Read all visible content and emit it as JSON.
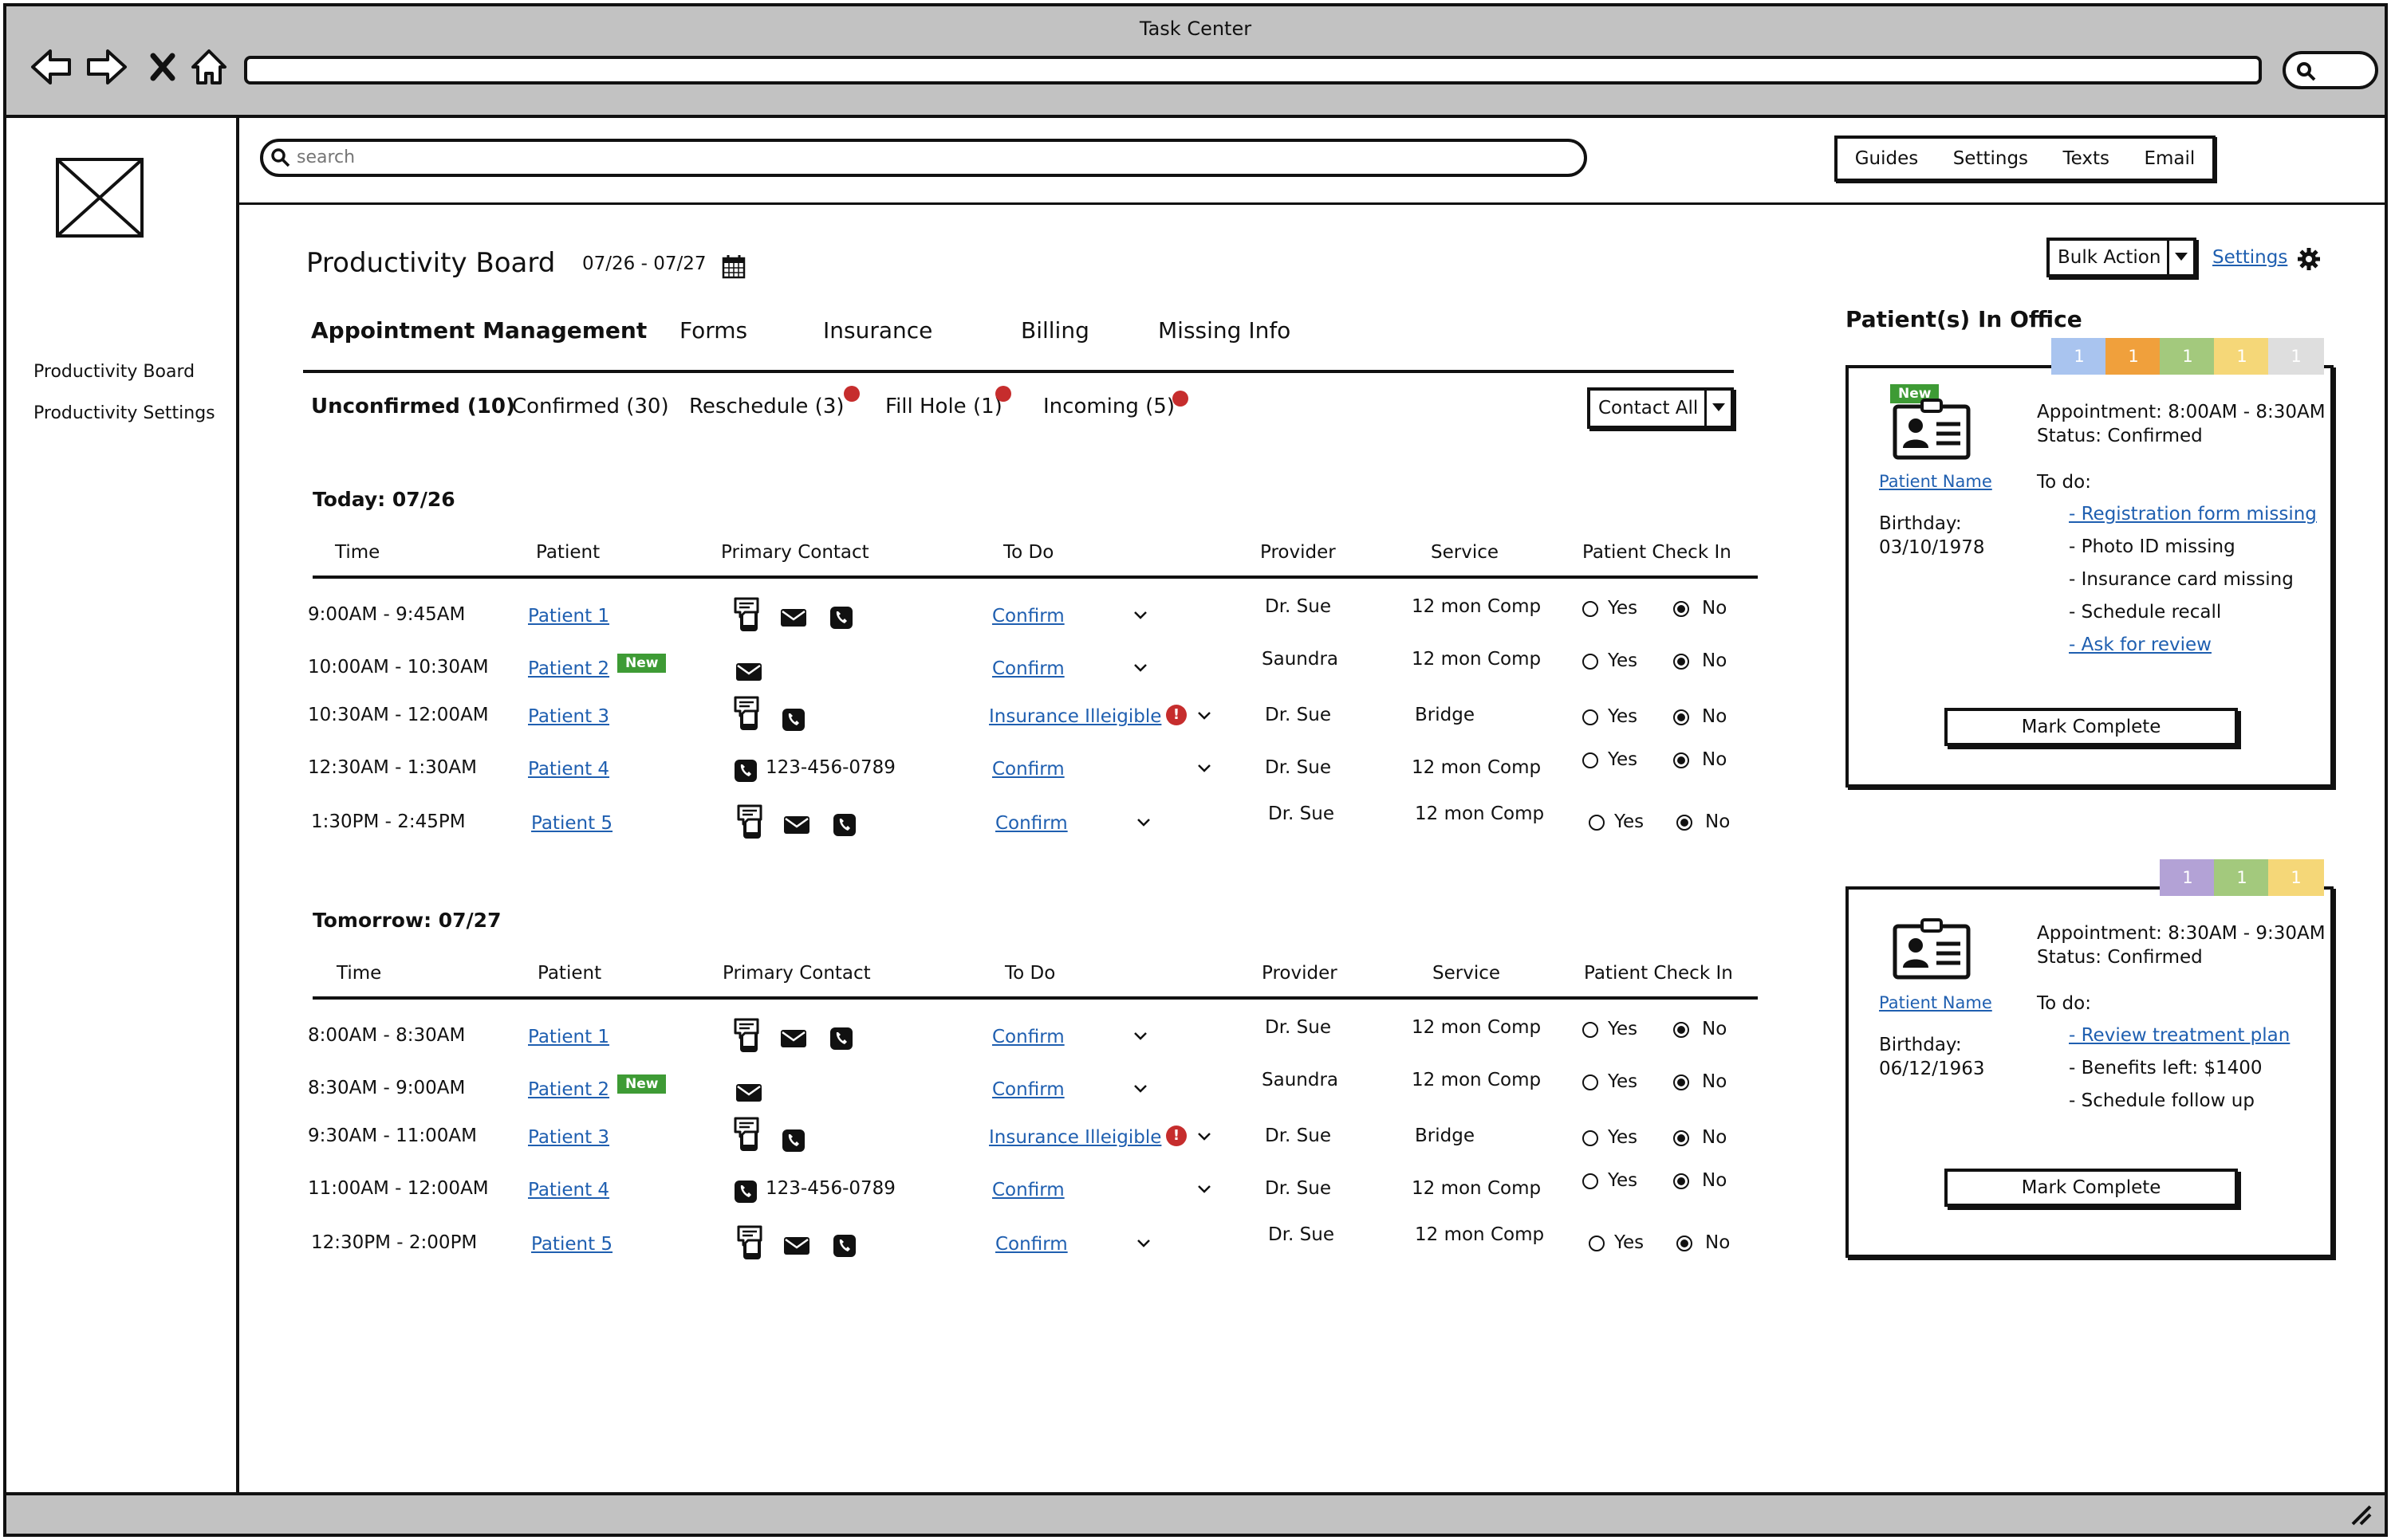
{
  "window": {
    "title": "Task Center"
  },
  "sidebar": {
    "items": [
      {
        "label": "Productivity Board"
      },
      {
        "label": "Productivity Settings"
      }
    ]
  },
  "search": {
    "placeholder": "search"
  },
  "top_menu": {
    "items": [
      {
        "label": "Guides"
      },
      {
        "label": "Settings"
      },
      {
        "label": "Texts"
      },
      {
        "label": "Email"
      }
    ]
  },
  "board": {
    "title": "Productivity Board",
    "date_range": "07/26 - 07/27",
    "bulk_action_label": "Bulk Action",
    "settings_label": "Settings",
    "tabs": [
      {
        "label": "Appointment Management",
        "active": true
      },
      {
        "label": "Forms"
      },
      {
        "label": "Insurance"
      },
      {
        "label": "Billing"
      },
      {
        "label": "Missing Info"
      }
    ],
    "subtabs": [
      {
        "label": "Unconfirmed (10)",
        "active": true
      },
      {
        "label": "Confirmed (30)"
      },
      {
        "label": "Reschedule (3)",
        "alert": true
      },
      {
        "label": "Fill Hole (1)",
        "alert": true
      },
      {
        "label": "Incoming (5)",
        "alert": true
      }
    ],
    "contact_all_label": "Contact All",
    "columns": [
      "Time",
      "Patient",
      "Primary Contact",
      "To Do",
      "Provider",
      "Service",
      "Patient Check In"
    ],
    "yes_label": "Yes",
    "no_label": "No",
    "new_badge": "New",
    "sections": [
      {
        "title": "Today: 07/26",
        "rows": [
          {
            "time": "9:00AM - 9:45AM",
            "patient": "Patient 1",
            "new": false,
            "contact": "icons-all",
            "todo": "Confirm",
            "warning": false,
            "provider": "Dr. Sue",
            "service": "12 mon Comp",
            "checkin": "No"
          },
          {
            "time": "10:00AM - 10:30AM",
            "patient": "Patient 2",
            "new": true,
            "contact": "email",
            "todo": "Confirm",
            "warning": false,
            "provider": "Saundra",
            "service": "12 mon Comp",
            "checkin": "No"
          },
          {
            "time": "10:30AM - 12:00AM",
            "patient": "Patient 3",
            "new": false,
            "contact": "text-phone",
            "todo": "Insurance Illeigible",
            "warning": true,
            "provider": "Dr. Sue",
            "service": "Bridge",
            "checkin": "No"
          },
          {
            "time": "12:30AM - 1:30AM",
            "patient": "Patient 4",
            "new": false,
            "contact": "phone-number",
            "phone": "123-456-0789",
            "todo": "Confirm",
            "warning": false,
            "provider": "Dr. Sue",
            "service": "12 mon Comp",
            "checkin": "No"
          },
          {
            "time": "1:30PM - 2:45PM",
            "patient": "Patient 5",
            "new": false,
            "contact": "icons-all",
            "todo": "Confirm",
            "warning": false,
            "provider": "Dr. Sue",
            "service": "12 mon Comp",
            "checkin": "No"
          }
        ]
      },
      {
        "title": "Tomorrow: 07/27",
        "rows": [
          {
            "time": "8:00AM - 8:30AM",
            "patient": "Patient 1",
            "new": false,
            "contact": "icons-all",
            "todo": "Confirm",
            "warning": false,
            "provider": "Dr. Sue",
            "service": "12 mon Comp",
            "checkin": "No"
          },
          {
            "time": "8:30AM - 9:00AM",
            "patient": "Patient 2",
            "new": true,
            "contact": "email",
            "todo": "Confirm",
            "warning": false,
            "provider": "Saundra",
            "service": "12 mon Comp",
            "checkin": "No"
          },
          {
            "time": "9:30AM - 11:00AM",
            "patient": "Patient 3",
            "new": false,
            "contact": "text-phone",
            "todo": "Insurance Illeigible",
            "warning": true,
            "provider": "Dr. Sue",
            "service": "Bridge",
            "checkin": "No"
          },
          {
            "time": "11:00AM - 12:00AM",
            "patient": "Patient 4",
            "new": false,
            "contact": "phone-number",
            "phone": "123-456-0789",
            "todo": "Confirm",
            "warning": false,
            "provider": "Dr. Sue",
            "service": "12 mon Comp",
            "checkin": "No"
          },
          {
            "time": "12:30PM - 2:00PM",
            "patient": "Patient 5",
            "new": false,
            "contact": "icons-all",
            "todo": "Confirm",
            "warning": false,
            "provider": "Dr. Sue",
            "service": "12 mon Comp",
            "checkin": "No"
          }
        ]
      }
    ]
  },
  "in_office": {
    "title": "Patient(s) In Office",
    "cards": [
      {
        "chips": [
          {
            "value": "1",
            "color": "#a9c4ef"
          },
          {
            "value": "1",
            "color": "#f0a03c"
          },
          {
            "value": "1",
            "color": "#a3c97d"
          },
          {
            "value": "1",
            "color": "#f5d778"
          },
          {
            "value": "1",
            "color": "#dedede"
          }
        ],
        "new": true,
        "patient_name": "Patient Name",
        "birthday_label": "Birthday:",
        "birthday": "03/10/1978",
        "appointment": "Appointment: 8:00AM - 8:30AM",
        "status": "Status: Confirmed",
        "todo_label": "To do:",
        "todos": [
          {
            "text": "- Registration form missing",
            "link": true
          },
          {
            "text": "- Photo ID missing",
            "link": false
          },
          {
            "text": "- Insurance card missing",
            "link": false
          },
          {
            "text": "- Schedule recall",
            "link": false
          },
          {
            "text": "- Ask for review",
            "link": true
          }
        ],
        "button": "Mark Complete"
      },
      {
        "chips": [
          {
            "value": "1",
            "color": "#b3a2d6"
          },
          {
            "value": "1",
            "color": "#a3c97d"
          },
          {
            "value": "1",
            "color": "#f5d778"
          }
        ],
        "new": false,
        "patient_name": "Patient Name",
        "birthday_label": "Birthday:",
        "birthday": "06/12/1963",
        "appointment": "Appointment: 8:30AM - 9:30AM",
        "status": "Status: Confirmed",
        "todo_label": "To do:",
        "todos": [
          {
            "text": "- Review treatment plan",
            "link": true
          },
          {
            "text": "- Benefits left: $1400",
            "link": false
          },
          {
            "text": "- Schedule follow up",
            "link": false
          }
        ],
        "button": "Mark Complete"
      }
    ]
  }
}
